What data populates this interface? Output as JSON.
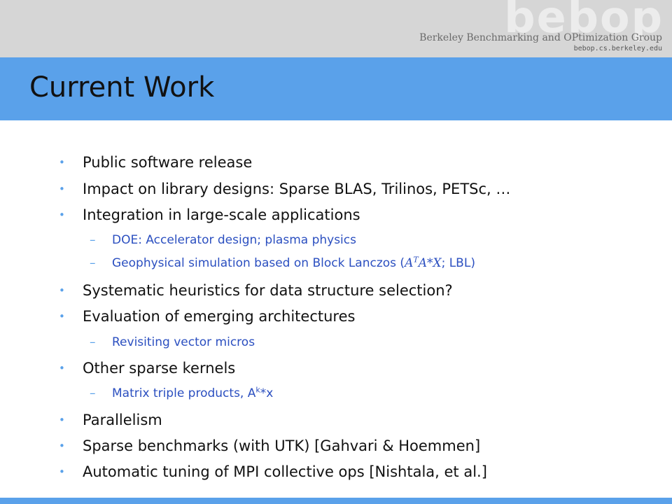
{
  "header": {
    "logo": "bebop",
    "group_name": "Berkeley Benchmarking and OPtimization Group",
    "url": "bebop.cs.berkeley.edu"
  },
  "slide": {
    "title": "Current Work",
    "bullets": [
      "Public software release",
      "Impact on library designs: Sparse BLAS, Trilinos, PETSc, …",
      "Integration in large-scale applications",
      "Systematic heuristics for data structure selection?",
      "Evaluation of emerging architectures",
      "Other sparse kernels",
      "Parallelism",
      "Sparse benchmarks (with UTK) [Gahvari & Hoemmen]",
      "Automatic tuning of MPI collective ops [Nishtala, et al.]"
    ],
    "sub": {
      "doe": "DOE: Accelerator design; plasma physics",
      "geo_prefix": "Geophysical simulation based on Block Lanczos (",
      "geo_math_a": "A",
      "geo_math_sup": "T",
      "geo_math_rest": "A*X",
      "geo_suffix": "; LBL)",
      "vector": "Revisiting vector micros",
      "triple_prefix": "Matrix triple products, A",
      "triple_sup": "k",
      "triple_suffix": "*x"
    },
    "bullet_glyph": "•",
    "dash_glyph": "–"
  },
  "colors": {
    "accent": "#5aa1ea",
    "sub_text": "#2b4fc0",
    "header_gray": "#d6d6d6"
  }
}
